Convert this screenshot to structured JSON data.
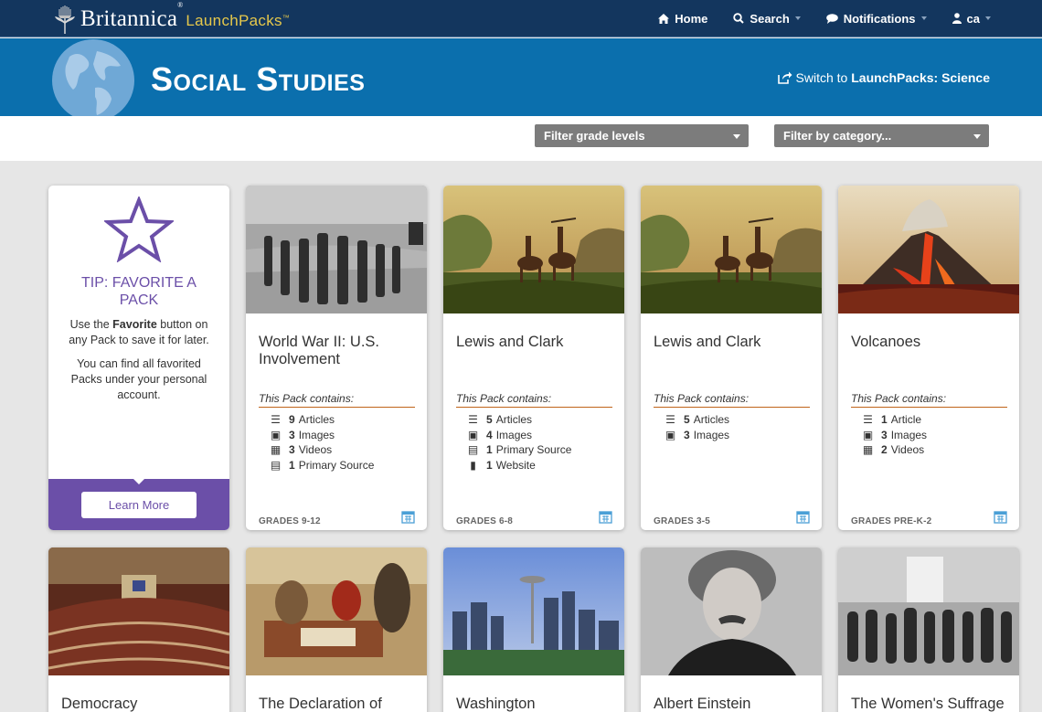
{
  "header": {
    "brand_name": "Britannica",
    "brand_reg": "®",
    "brand_product": "LaunchPacks",
    "brand_tm": "™",
    "nav": [
      {
        "label": "Home",
        "icon": "home-icon"
      },
      {
        "label": "Search",
        "icon": "search-icon"
      },
      {
        "label": "Notifications",
        "icon": "chat-bubble-icon"
      },
      {
        "label": "ca",
        "icon": "user-icon"
      }
    ]
  },
  "banner": {
    "title": "Social Studies",
    "switch_prefix": "Switch to ",
    "switch_target": "LaunchPacks: Science"
  },
  "filters": {
    "grade": "Filter grade levels",
    "category": "Filter by category..."
  },
  "tip": {
    "title": "TIP: FAVORITE A PACK",
    "text1_pre": "Use the ",
    "text1_bold": "Favorite",
    "text1_post": " button on any Pack to save it for later.",
    "text2": "You can find all favorited Packs under your personal account.",
    "button": "Learn More"
  },
  "contains_label": "This Pack contains:",
  "cards": [
    {
      "title": "World War II: U.S. Involvement",
      "grades": "GRADES 9-12",
      "items": [
        {
          "count": "9",
          "label": "Articles",
          "icon": "list-icon"
        },
        {
          "count": "3",
          "label": "Images",
          "icon": "image-icon"
        },
        {
          "count": "3",
          "label": "Videos",
          "icon": "film-icon"
        },
        {
          "count": "1",
          "label": "Primary Source",
          "icon": "document-icon"
        }
      ]
    },
    {
      "title": "Lewis and Clark",
      "grades": "GRADES 6-8",
      "items": [
        {
          "count": "5",
          "label": "Articles",
          "icon": "list-icon"
        },
        {
          "count": "4",
          "label": "Images",
          "icon": "image-icon"
        },
        {
          "count": "1",
          "label": "Primary Source",
          "icon": "document-icon"
        },
        {
          "count": "1",
          "label": "Website",
          "icon": "bookmark-icon"
        }
      ]
    },
    {
      "title": "Lewis and Clark",
      "grades": "GRADES 3-5",
      "items": [
        {
          "count": "5",
          "label": "Articles",
          "icon": "list-icon"
        },
        {
          "count": "3",
          "label": "Images",
          "icon": "image-icon"
        }
      ]
    },
    {
      "title": "Volcanoes",
      "grades": "GRADES PRE-K-2",
      "items": [
        {
          "count": "1",
          "label": "Article",
          "icon": "list-icon"
        },
        {
          "count": "3",
          "label": "Images",
          "icon": "image-icon"
        },
        {
          "count": "2",
          "label": "Videos",
          "icon": "film-icon"
        }
      ]
    }
  ],
  "row2_cards": [
    {
      "title": "Democracy"
    },
    {
      "title": "The Declaration of"
    },
    {
      "title": "Washington"
    },
    {
      "title": "Albert Einstein"
    },
    {
      "title": "The Women's Suffrage"
    }
  ],
  "colors": {
    "topbar": "#13365e",
    "banner": "#0b6fad",
    "tip_purple": "#6b4fa8",
    "divider_orange": "#c0641a",
    "brand_gold": "#e6c84b"
  }
}
